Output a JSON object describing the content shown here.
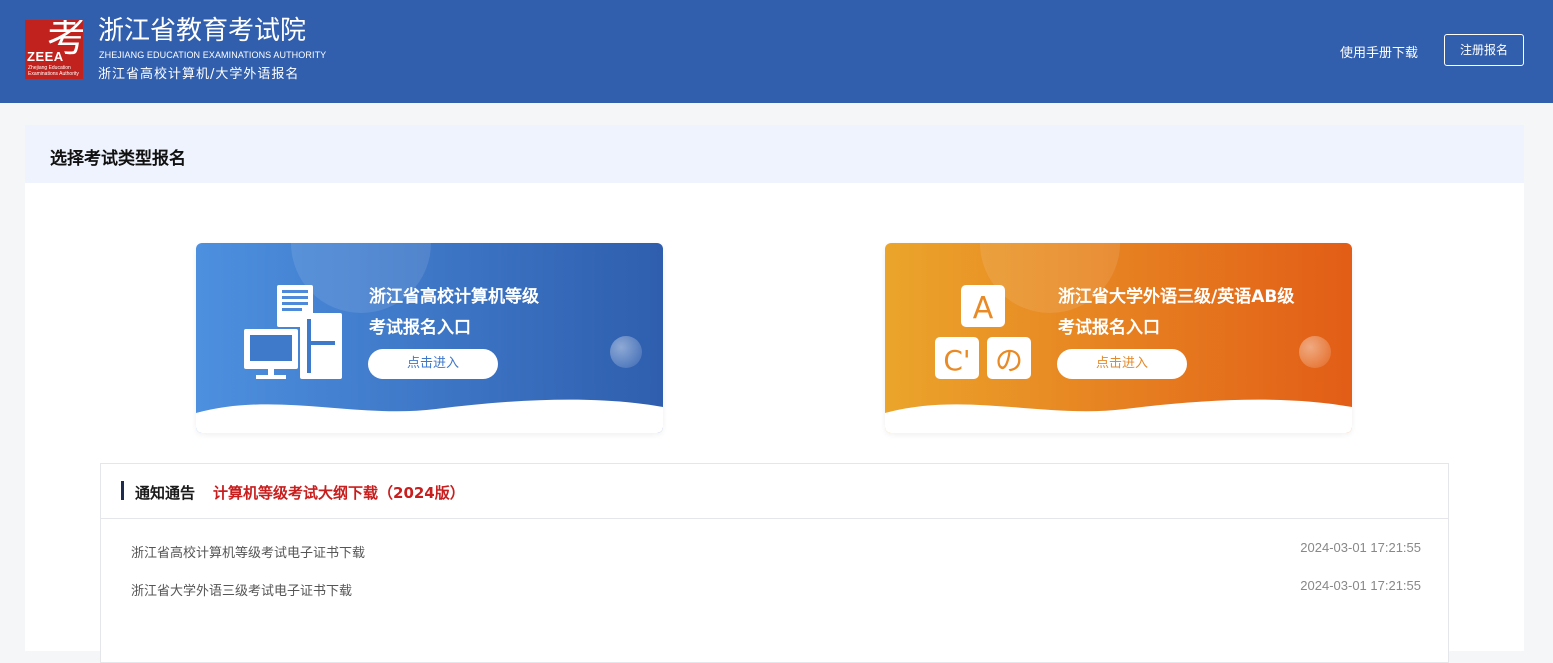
{
  "header": {
    "logo_char": "考",
    "logo_abbr": "ZEEA",
    "logo_sub": "Zhejiang Education Examinations Authority",
    "org_title": "浙江省教育考试院",
    "org_en": "ZHEJIANG EDUCATION EXAMINATIONS AUTHORITY",
    "org_sub": "浙江省高校计算机/大学外语报名",
    "manual_link": "使用手册下载",
    "register_button": "注册报名",
    "background_color": "#315fae"
  },
  "main": {
    "section_title": "选择考试类型报名",
    "cards": [
      {
        "title_line1": "浙江省高校计算机等级",
        "title_line2": "考试报名入口",
        "button": "点击进入",
        "icon": "computer-icon",
        "color_from": "#4d90df",
        "color_to": "#2f5eae"
      },
      {
        "title_line1": "浙江省大学外语三级/英语AB级",
        "title_line2": "考试报名入口",
        "button": "点击进入",
        "icon": "language-letters-icon",
        "icon_letters": [
          "A",
          "C'",
          "の"
        ],
        "color_from": "#eba52b",
        "color_to": "#e25d17"
      }
    ]
  },
  "notice": {
    "label": "通知通告",
    "highlight": "计算机等级考试大纲下载（2024版）",
    "items": [
      {
        "title": "浙江省高校计算机等级考试电子证书下载",
        "date": "2024-03-01 17:21:55"
      },
      {
        "title": "浙江省大学外语三级考试电子证书下载",
        "date": "2024-03-01 17:21:55"
      }
    ]
  }
}
